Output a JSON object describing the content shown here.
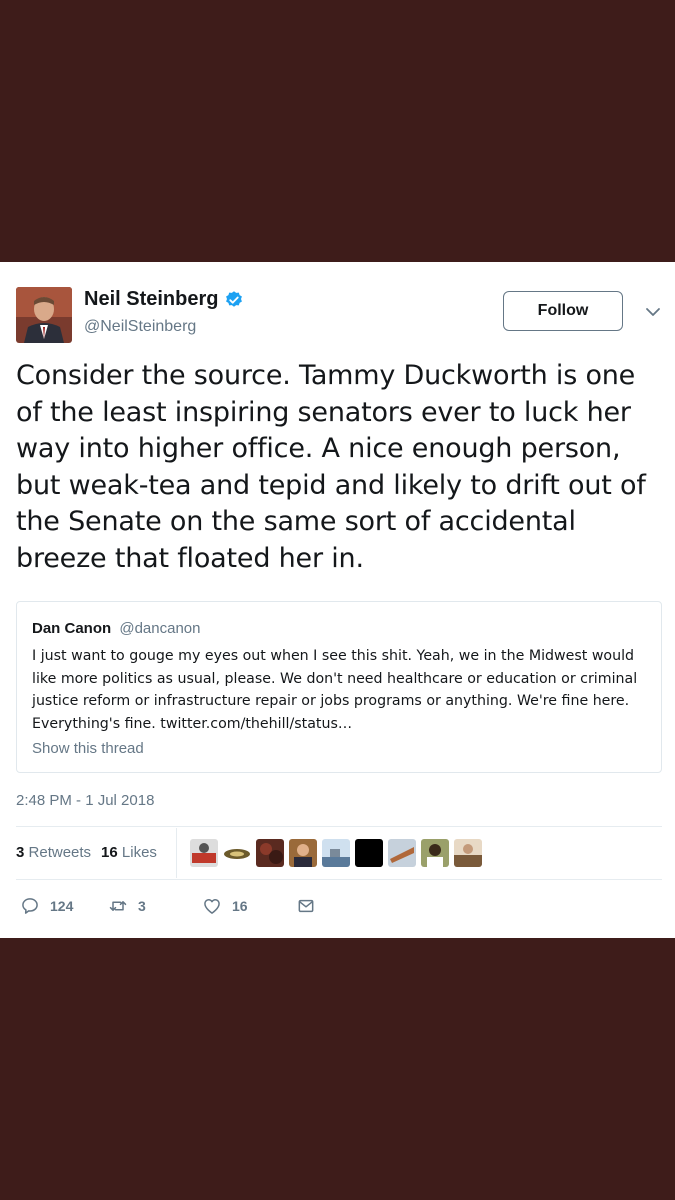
{
  "tweet": {
    "author_name": "Neil Steinberg",
    "author_handle": "@NeilSteinberg",
    "follow_label": "Follow",
    "text": "Consider the source. Tammy Duckworth is one of the least inspiring senators ever to luck her way into higher office. A nice enough person, but weak-tea and tepid and likely to drift out of the Senate on the same sort of accidental breeze that floated her in.",
    "timestamp": "2:48 PM - 1 Jul 2018"
  },
  "quoted": {
    "name": "Dan Canon",
    "handle": "@dancanon",
    "text": "I just want to gouge my eyes out when I see this shit. Yeah, we in the Midwest would like more politics as usual, please. We don't need healthcare or education or criminal justice reform or infrastructure repair or jobs programs or anything. We're fine here. Everything's fine. twitter.com/thehill/status…",
    "show_thread": "Show this thread"
  },
  "stats": {
    "retweets_count": "3",
    "retweets_label": "Retweets",
    "likes_count": "16",
    "likes_label": "Likes"
  },
  "actions": {
    "replies": "124",
    "retweets": "3",
    "likes": "16"
  },
  "colors": {
    "background": "#3e1c1a",
    "verified": "#1da1f2",
    "muted": "#657786"
  }
}
